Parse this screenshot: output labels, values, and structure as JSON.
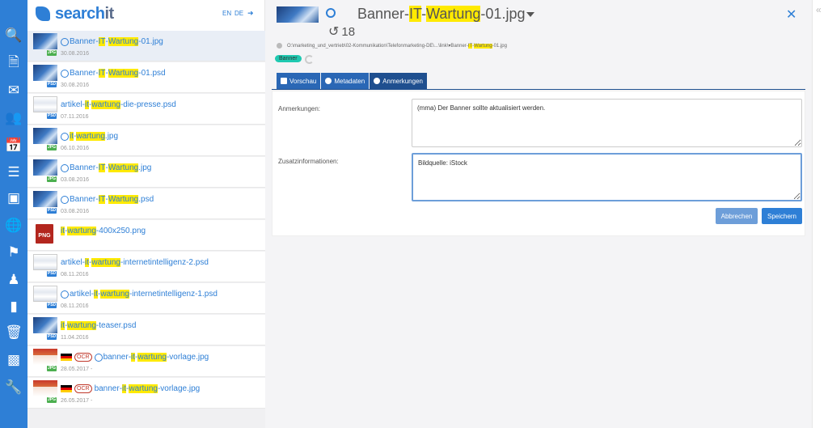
{
  "app": {
    "logo_main": "search",
    "logo_it": "it",
    "lang_en": "EN",
    "lang_de": "DE"
  },
  "results": [
    {
      "name_pre": "Banner-",
      "hl1": "IT",
      "mid": "-",
      "hl2": "Wartung",
      "post": "-01.jpg",
      "date": "30.08.2016",
      "ext": "JPG"
    },
    {
      "name_pre": "Banner-",
      "hl1": "IT",
      "mid": "-",
      "hl2": "Wartung",
      "post": "-01.psd",
      "date": "30.08.2016",
      "ext": "PSD"
    },
    {
      "name_pre": "artikel-",
      "hl1": "it",
      "mid": "-",
      "hl2": "wartung",
      "post": "-die-presse.psd",
      "date": "07.11.2016",
      "ext": "PSD"
    },
    {
      "name_pre": "",
      "hl1": "it",
      "mid": "-",
      "hl2": "wartung",
      "post": ".jpg",
      "date": "06.10.2016",
      "ext": "JPG"
    },
    {
      "name_pre": "Banner-",
      "hl1": "IT",
      "mid": "-",
      "hl2": "Wartung",
      "post": ".jpg",
      "date": "03.08.2016",
      "ext": "JPG"
    },
    {
      "name_pre": "Banner-",
      "hl1": "IT",
      "mid": "-",
      "hl2": "Wartung",
      "post": ".psd",
      "date": "03.08.2016",
      "ext": "PSD"
    },
    {
      "name_pre": "",
      "hl1": "it",
      "mid": "-",
      "hl2": "wartung",
      "post": "-400x250.png",
      "date": "",
      "ext": "PNG"
    },
    {
      "name_pre": "artikel-",
      "hl1": "it",
      "mid": "-",
      "hl2": "wartung",
      "post": "-internetintelligenz-2.psd",
      "date": "08.11.2016",
      "ext": "PSD"
    },
    {
      "name_pre": "artikel-",
      "hl1": "it",
      "mid": "-",
      "hl2": "wartung",
      "post": "-internetintelligenz-1.psd",
      "date": "08.11.2016",
      "ext": "PSD"
    },
    {
      "name_pre": "",
      "hl1": "it",
      "mid": "-",
      "hl2": "wartung",
      "post": "-teaser.psd",
      "date": "11.04.2016",
      "ext": "PSD"
    },
    {
      "name_pre": "banner-",
      "hl1": "it",
      "mid": "-",
      "hl2": "wartung",
      "post": "-vorlage.jpg",
      "date": "28.05.2017 -",
      "ext": "JPG",
      "ocr": "OCR"
    },
    {
      "name_pre": "banner-",
      "hl1": "it",
      "mid": "-",
      "hl2": "wartung",
      "post": "-vorlage.jpg",
      "date": "26.05.2017 -",
      "ext": "JPG",
      "ocr": "OCR"
    }
  ],
  "detail": {
    "title_pre": "Banner-",
    "title_hl1": "IT",
    "title_mid": "-",
    "title_hl2": "Wartung",
    "title_post": "-01.jpg",
    "history_count": "18",
    "path_pre": "O:\\marketing_und_vertrieb\\02-Kommunikation\\Telefonmarketing-DE\\...\\link\\▾Banner-",
    "path_hl1": "IT",
    "path_mid": "-",
    "path_hl2": "Wartung",
    "path_post": "-01.jpg",
    "tag": "Banner",
    "tabs": {
      "preview": "Vorschau",
      "metadata": "Metadaten",
      "notes": "Anmerkungen"
    },
    "notes_label": "Anmerkungen:",
    "notes_value": "(mma) Der Banner sollte aktualisiert werden.",
    "extra_label": "Zusatzinformationen:",
    "extra_value": "Bildquelle: iStock",
    "cancel": "Abbrechen",
    "save": "Speichern"
  },
  "colors": {
    "accent": "#2e7fd6",
    "highlight": "#ffea00",
    "tag": "#1fc9b1"
  }
}
